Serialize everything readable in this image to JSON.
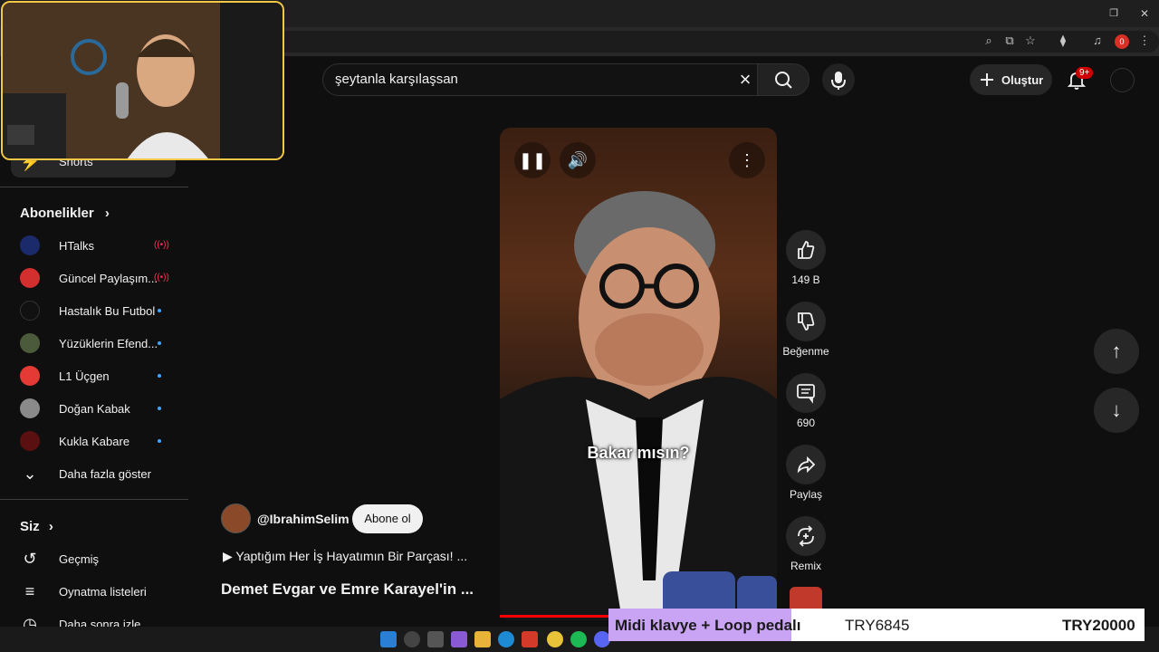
{
  "search": {
    "query": "şeytanla karşılaşsan"
  },
  "header": {
    "create_label": "Oluştur",
    "notification_count": "9+"
  },
  "browser": {
    "profile_badge": "0"
  },
  "sidebar": {
    "shorts_label": "Shorts",
    "subscriptions_title": "Abonelikler",
    "subscriptions": [
      {
        "name": "HTalks",
        "status": "live",
        "avatar_color": "#1a2a6b"
      },
      {
        "name": "Güncel Paylaşım...",
        "status": "live",
        "avatar_color": "#d32f2f"
      },
      {
        "name": "Hastalık Bu Futbol",
        "status": "new",
        "avatar_color": "#111111"
      },
      {
        "name": "Yüzüklerin Efend...",
        "status": "new",
        "avatar_color": "#4a5a3a"
      },
      {
        "name": "L1 Üçgen",
        "status": "new",
        "avatar_color": "#e53935"
      },
      {
        "name": "Doğan Kabak",
        "status": "new",
        "avatar_color": "#8a8a8a"
      },
      {
        "name": "Kukla Kabare",
        "status": "new",
        "avatar_color": "#5a1010"
      }
    ],
    "show_more_label": "Daha fazla göster",
    "you_title": "Siz",
    "you_items": [
      {
        "label": "Geçmiş",
        "icon": "history-icon"
      },
      {
        "label": "Oynatma listeleri",
        "icon": "playlists-icon"
      },
      {
        "label": "Daha sonra izle",
        "icon": "watch-later-icon"
      }
    ]
  },
  "video": {
    "caption": "Bakar mısın?",
    "progress": 0.46
  },
  "actions": {
    "like_count": "149 B",
    "dislike_label": "Beğenme",
    "comment_count": "690",
    "share_label": "Paylaş",
    "remix_label": "Remix"
  },
  "channel": {
    "handle": "@IbrahimSelim",
    "subscribe_label": "Abone ol",
    "description": "▶ Yaptığım Her İş Hayatımın Bir Parçası! ...",
    "title": "Demet Evgar ve Emre Karayel'in ..."
  },
  "banner": {
    "title": "Midi klavye + Loop pedalı",
    "code": "TRY6845",
    "amount": "TRY20000"
  }
}
